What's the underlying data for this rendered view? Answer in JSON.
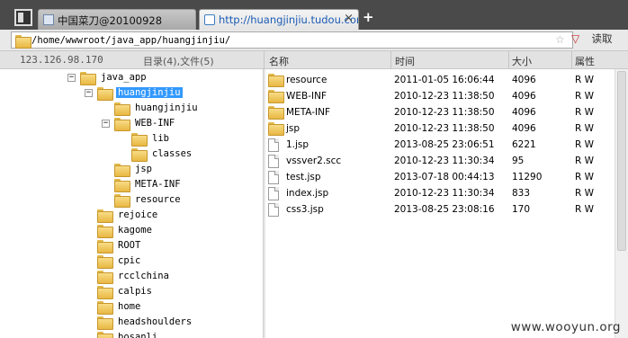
{
  "browser": {
    "tabs": [
      {
        "title": "中国菜刀@20100928"
      },
      {
        "title": "http://huangjinjiu.tudou.com/..."
      }
    ],
    "new_tab": "+",
    "close_glyph": "×"
  },
  "address": {
    "path": "/home/wwwroot/java_app/huangjinjiu/",
    "star_glyph": "☆",
    "dropdown_glyph": "▽",
    "read_label": "读取"
  },
  "info": {
    "ip": "123.126.98.170",
    "summary": "目录(4),文件(5)"
  },
  "columns": {
    "name": "名称",
    "time": "时间",
    "size": "大小",
    "attr": "属性"
  },
  "tree": [
    {
      "label": "java_app",
      "toggle": "−"
    },
    {
      "label": "huangjinjiu",
      "toggle": "−",
      "selected": true
    },
    {
      "label": "huangjinjiu",
      "toggle": ""
    },
    {
      "label": "WEB-INF",
      "toggle": "−"
    },
    {
      "label": "lib",
      "toggle": ""
    },
    {
      "label": "classes",
      "toggle": ""
    },
    {
      "label": "jsp",
      "toggle": ""
    },
    {
      "label": "META-INF",
      "toggle": ""
    },
    {
      "label": "resource",
      "toggle": ""
    },
    {
      "label": "rejoice",
      "toggle": ""
    },
    {
      "label": "kagome",
      "toggle": ""
    },
    {
      "label": "ROOT",
      "toggle": ""
    },
    {
      "label": "cpic",
      "toggle": ""
    },
    {
      "label": "rcclchina",
      "toggle": ""
    },
    {
      "label": "calpis",
      "toggle": ""
    },
    {
      "label": "home",
      "toggle": ""
    },
    {
      "label": "headshoulders",
      "toggle": ""
    },
    {
      "label": "bosanli",
      "toggle": ""
    }
  ],
  "files": [
    {
      "name": "resource",
      "time": "2011-01-05 16:06:44",
      "size": "4096",
      "attr": "R W",
      "type": "folder"
    },
    {
      "name": "WEB-INF",
      "time": "2010-12-23 11:38:50",
      "size": "4096",
      "attr": "R W",
      "type": "folder"
    },
    {
      "name": "META-INF",
      "time": "2010-12-23 11:38:50",
      "size": "4096",
      "attr": "R W",
      "type": "folder"
    },
    {
      "name": "jsp",
      "time": "2010-12-23 11:38:50",
      "size": "4096",
      "attr": "R W",
      "type": "folder"
    },
    {
      "name": "1.jsp",
      "time": "2013-08-25 23:06:51",
      "size": "6221",
      "attr": "R W",
      "type": "file"
    },
    {
      "name": "vssver2.scc",
      "time": "2010-12-23 11:30:34",
      "size": "95",
      "attr": "R W",
      "type": "file"
    },
    {
      "name": "test.jsp",
      "time": "2013-07-18 00:44:13",
      "size": "11290",
      "attr": "R W",
      "type": "file"
    },
    {
      "name": "index.jsp",
      "time": "2010-12-23 11:30:34",
      "size": "833",
      "attr": "R W",
      "type": "file"
    },
    {
      "name": "css3.jsp",
      "time": "2013-08-25 23:08:16",
      "size": "170",
      "attr": "R W",
      "type": "file"
    }
  ],
  "watermark": "www.wooyun.org"
}
